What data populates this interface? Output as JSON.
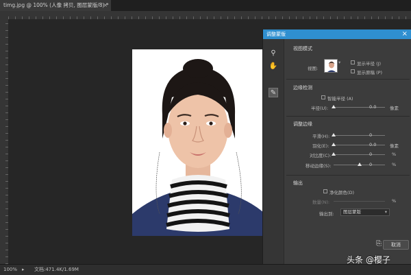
{
  "tab": {
    "title": "timg.jpg @ 100% (人像 拷贝, 图层蒙版/8) *",
    "close": "×"
  },
  "status": {
    "zoom": "100%",
    "doc": "文档:471.4K/1.69M",
    "arrow": "▸"
  },
  "dialog": {
    "title": "调整蒙版",
    "close": "×",
    "view_mode": {
      "heading": "视图模式",
      "view_label": "视图:",
      "show_radius": "显示半径 (J)",
      "show_original": "显示原稿 (P)"
    },
    "edge_detection": {
      "heading": "边缘检测",
      "smart_radius": "智能半径 (A)",
      "radius_label": "半径(U):",
      "radius_value": "0.0",
      "radius_unit": "像素",
      "radius_level": 0
    },
    "adjust_edge": {
      "heading": "调整边缘",
      "smooth_label": "平滑(H):",
      "smooth_value": "0",
      "smooth_level": 0,
      "feather_label": "羽化(E):",
      "feather_value": "0.0",
      "feather_unit": "像素",
      "feather_level": 0,
      "contrast_label": "对比度(C):",
      "contrast_value": "0",
      "contrast_unit": "%",
      "contrast_level": 0,
      "shift_label": "移动边缘(S):",
      "shift_value": "0",
      "shift_unit": "%",
      "shift_level": 0.5
    },
    "output": {
      "heading": "输出",
      "decontaminate": "净化颜色(D)",
      "amount_label": "数量(N):",
      "amount_unit": "%",
      "output_to_label": "输出到:",
      "output_to_value": "图层蒙版"
    },
    "cancel": "取消"
  },
  "watermark": "头条 @樱子",
  "colors": {
    "accent": "#2f8fd0",
    "annotation": "#d32020"
  }
}
